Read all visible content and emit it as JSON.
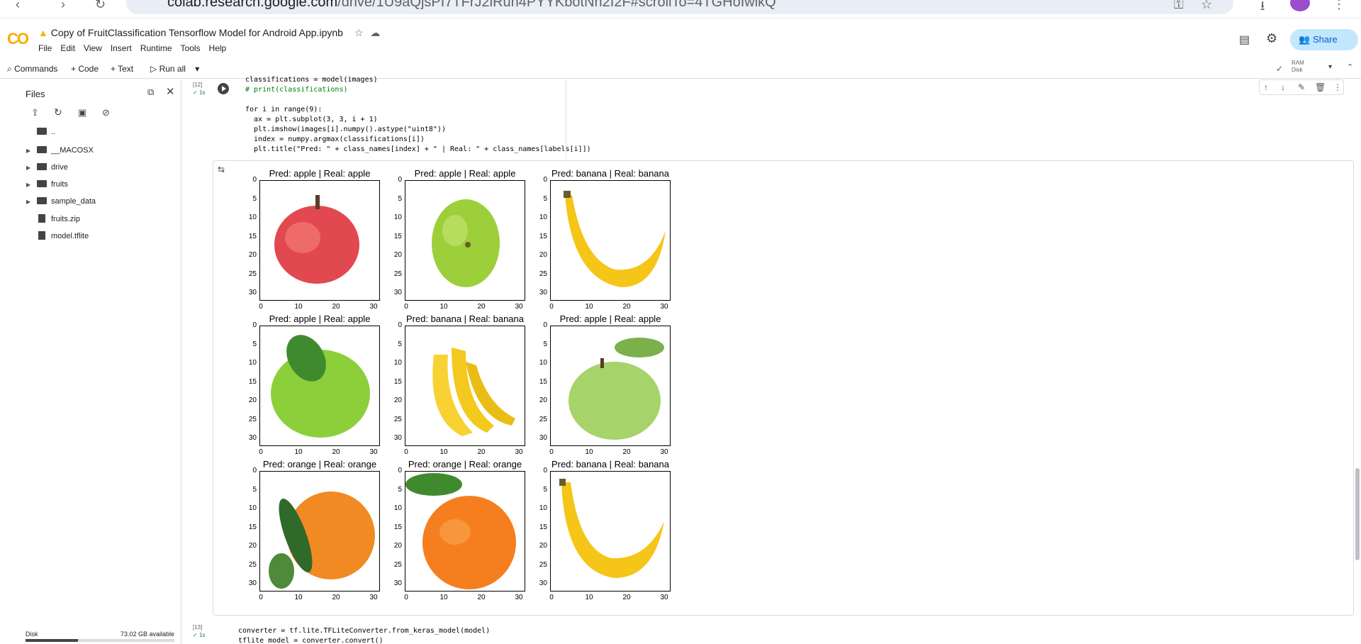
{
  "browser": {
    "url_host": "colab.research.google.com",
    "url_path": "/drive/1U9aQjsPI7TFrJ2lRuh4PYYKbotNn2I2F#scrollTo=4TGHoIwlkQ"
  },
  "notebook": {
    "title": "Copy of FruitClassification Tensorflow Model for Android App.ipynb",
    "menus": [
      "File",
      "Edit",
      "View",
      "Insert",
      "Runtime",
      "Tools",
      "Help"
    ],
    "share_label": "Share"
  },
  "toolbar": {
    "commands": "Commands",
    "code": "+ Code",
    "text": "+ Text",
    "run_all": "Run all",
    "ram": "RAM",
    "disk": "Disk"
  },
  "sidebar": {
    "title": "Files",
    "items": [
      {
        "label": "..",
        "kind": "folder"
      },
      {
        "label": "__MACOSX",
        "kind": "folder"
      },
      {
        "label": "drive",
        "kind": "folder"
      },
      {
        "label": "fruits",
        "kind": "folder"
      },
      {
        "label": "sample_data",
        "kind": "folder"
      },
      {
        "label": "fruits.zip",
        "kind": "file"
      },
      {
        "label": "model.tflite",
        "kind": "file"
      }
    ],
    "disk_label": "Disk",
    "disk_available": "73.02 GB available",
    "disk_used_fraction": 0.35
  },
  "cells": {
    "cell12": {
      "exec_count": "[12]",
      "duration": "1s",
      "code_lines": [
        "classifications = model(images)",
        "# print(classifications)",
        "",
        "for i in range(9):",
        "  ax = plt.subplot(3, 3, i + 1)",
        "  plt.imshow(images[i].numpy().astype(\"uint8\"))",
        "  index = numpy.argmax(classifications[i])",
        "  plt.title(\"Pred: \" + class_names[index] + \" | Real: \" + class_names[labels[i]])"
      ]
    },
    "cell13": {
      "exec_count": "[13]",
      "duration": "1s",
      "code_lines": [
        "converter = tf.lite.TFLiteConverter.from_keras_model(model)",
        "tflite_model = converter.convert()"
      ]
    }
  },
  "plots": [
    {
      "title": "Pred: apple | Real: apple",
      "fruit": "red-apple"
    },
    {
      "title": "Pred: apple | Real: apple",
      "fruit": "green-apple"
    },
    {
      "title": "Pred: banana | Real: banana",
      "fruit": "banana"
    },
    {
      "title": "Pred: apple | Real: apple",
      "fruit": "green-apple-leaf"
    },
    {
      "title": "Pred: banana | Real: banana",
      "fruit": "banana-bunch"
    },
    {
      "title": "Pred: apple | Real: apple",
      "fruit": "green-apple-stem"
    },
    {
      "title": "Pred: orange | Real: orange",
      "fruit": "orange-leaves"
    },
    {
      "title": "Pred: orange | Real: orange",
      "fruit": "orange"
    },
    {
      "title": "Pred: banana | Real: banana",
      "fruit": "banana-single"
    }
  ],
  "axes": {
    "yticks": [
      "0",
      "5",
      "10",
      "15",
      "20",
      "25",
      "30"
    ],
    "xticks": [
      "0",
      "10",
      "20",
      "30"
    ]
  }
}
